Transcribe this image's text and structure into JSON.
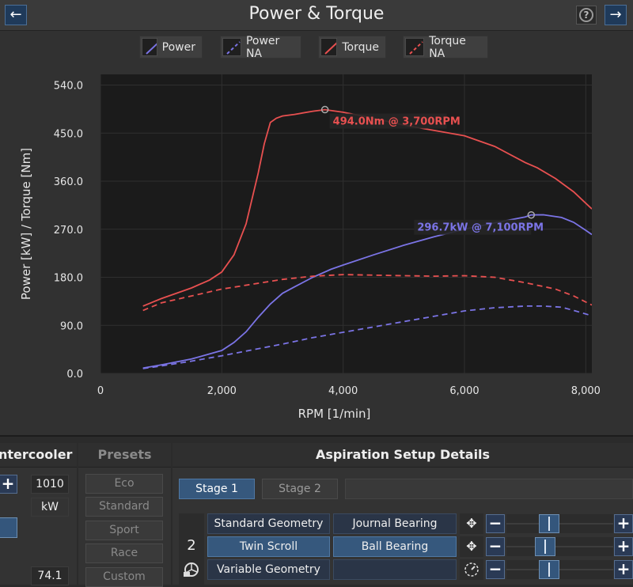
{
  "window": {
    "title": "Power & Torque",
    "back_icon": "arrow-left-icon",
    "forward_icon": "arrow-right-icon",
    "help_label": "?"
  },
  "legend": [
    {
      "label": "Power",
      "color": "#7b74e6",
      "dashed": false
    },
    {
      "label": "Power NA",
      "color": "#7b74e6",
      "dashed": true
    },
    {
      "label": "Torque",
      "color": "#e85050",
      "dashed": false
    },
    {
      "label": "Torque NA",
      "color": "#e85050",
      "dashed": true
    }
  ],
  "chart_data": {
    "type": "line",
    "xlabel": "RPM [1/min]",
    "ylabel": "Power [kW] / Torque [Nm]",
    "xlim": [
      0,
      8100
    ],
    "ylim": [
      0,
      560
    ],
    "x_ticks": [
      0,
      2000,
      4000,
      6000,
      8000
    ],
    "x_tick_labels": [
      "0",
      "2,000",
      "4,000",
      "6,000",
      "8,000"
    ],
    "y_ticks": [
      0,
      90,
      180,
      270,
      360,
      450,
      540
    ],
    "y_tick_labels": [
      "0.0",
      "90.0",
      "180.0",
      "270.0",
      "360.0",
      "450.0",
      "540.0"
    ],
    "grid": true,
    "series": [
      {
        "name": "Power",
        "color": "#7b74e6",
        "dashed": false,
        "x": [
          700,
          1000,
          1500,
          2000,
          2200,
          2400,
          2600,
          2800,
          3000,
          3200,
          3500,
          3800,
          4000,
          4500,
          5000,
          5500,
          6000,
          6500,
          7000,
          7100,
          7300,
          7600,
          7800,
          8000,
          8100
        ],
        "y": [
          10,
          16,
          27,
          43,
          58,
          78,
          105,
          130,
          150,
          162,
          180,
          195,
          203,
          222,
          240,
          256,
          270,
          282,
          293,
          296.7,
          297,
          292,
          283,
          268,
          260
        ]
      },
      {
        "name": "Power NA",
        "color": "#7b74e6",
        "dashed": true,
        "x": [
          700,
          1000,
          1500,
          2000,
          2500,
          3000,
          3500,
          4000,
          4500,
          5000,
          5500,
          6000,
          6500,
          7000,
          7300,
          7600,
          7800,
          8100
        ],
        "y": [
          9,
          14,
          23,
          33,
          44,
          55,
          67,
          77,
          87,
          97,
          107,
          117,
          123,
          126,
          126,
          124,
          118,
          108
        ]
      },
      {
        "name": "Torque",
        "color": "#e85050",
        "dashed": false,
        "x": [
          700,
          1000,
          1500,
          1800,
          2000,
          2200,
          2400,
          2600,
          2700,
          2800,
          2900,
          3000,
          3200,
          3500,
          3700,
          4000,
          4500,
          5000,
          5500,
          6000,
          6500,
          7000,
          7200,
          7500,
          7800,
          8100
        ],
        "y": [
          126,
          140,
          160,
          175,
          190,
          222,
          280,
          375,
          430,
          470,
          478,
          482,
          485,
          491,
          494,
          489,
          478,
          465,
          455,
          445,
          425,
          395,
          385,
          365,
          340,
          308
        ]
      },
      {
        "name": "Torque NA",
        "color": "#e85050",
        "dashed": true,
        "x": [
          700,
          1000,
          1500,
          2000,
          2500,
          3000,
          3500,
          4000,
          4500,
          5000,
          5500,
          6000,
          6500,
          7000,
          7500,
          7800,
          8100
        ],
        "y": [
          118,
          132,
          145,
          158,
          167,
          176,
          182,
          185,
          184,
          183,
          182,
          183,
          180,
          170,
          158,
          145,
          128
        ]
      }
    ],
    "annotations": [
      {
        "text": "494.0Nm @ 3,700RPM",
        "x": 3700,
        "y": 494,
        "color": "#e85050"
      },
      {
        "text": "296.7kW @ 7,100RPM",
        "x": 7100,
        "y": 296.7,
        "color": "#7b74e6"
      }
    ]
  },
  "intercooler": {
    "header": "Intercooler",
    "value_top": "1010",
    "unit": "kW",
    "value_bottom": "74.1",
    "plus_label": "+"
  },
  "presets": {
    "header": "Presets",
    "items": [
      "Eco",
      "Standard",
      "Sport",
      "Race",
      "Custom"
    ]
  },
  "aspiration": {
    "header": "Aspiration Setup Details",
    "stages": [
      "Stage 1",
      "Stage 2"
    ],
    "selected_stage": 0,
    "stage_number": "2",
    "turbo_icon": "turbo-icon",
    "rows": [
      {
        "left": "Standard Geometry",
        "right": "Journal Bearing",
        "left_selected": false,
        "right_selected": false,
        "icon": "move-icon",
        "slider_pos": 0.38
      },
      {
        "left": "Twin Scroll",
        "right": "Ball Bearing",
        "left_selected": true,
        "right_selected": true,
        "icon": "move-icon",
        "slider_pos": 0.33
      },
      {
        "left": "Variable Geometry",
        "right": "",
        "left_selected": false,
        "right_selected": false,
        "icon": "gauge-icon",
        "slider_pos": 0.38
      }
    ],
    "minus_label": "−",
    "plus_label": "+"
  }
}
